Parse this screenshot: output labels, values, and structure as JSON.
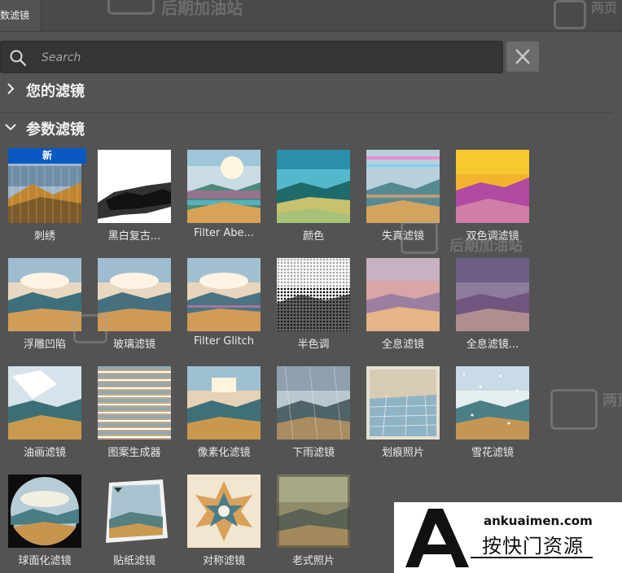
{
  "tab": {
    "label": "数滤镜"
  },
  "search": {
    "placeholder": "Search"
  },
  "sections": {
    "yours": "您的滤镜",
    "parametric": "参数滤镜"
  },
  "badge_new": "新",
  "filters": [
    {
      "label": "刺绣"
    },
    {
      "label": "黑白复古..."
    },
    {
      "label": "Filter Abe..."
    },
    {
      "label": "颜色"
    },
    {
      "label": "失真滤镜"
    },
    {
      "label": "双色调滤镜"
    },
    {
      "label": "浮雕凹陷"
    },
    {
      "label": "玻璃滤镜"
    },
    {
      "label": "Filter Glitch"
    },
    {
      "label": "半色调"
    },
    {
      "label": "全息滤镜"
    },
    {
      "label": "全息滤镜..."
    },
    {
      "label": "油画滤镜"
    },
    {
      "label": "图案生成器"
    },
    {
      "label": "像素化滤镜"
    },
    {
      "label": "下雨滤镜"
    },
    {
      "label": "划痕照片"
    },
    {
      "label": "雪花滤镜"
    },
    {
      "label": "球面化滤镜"
    },
    {
      "label": "贴纸滤镜"
    },
    {
      "label": "对称滤镜"
    },
    {
      "label": "老式照片"
    }
  ],
  "watermark": {
    "text": "后期加油站",
    "partial": "两页"
  },
  "ad": {
    "domain": "ankuaimen.com",
    "name": "按快门资源",
    "logo_letter": "A"
  }
}
